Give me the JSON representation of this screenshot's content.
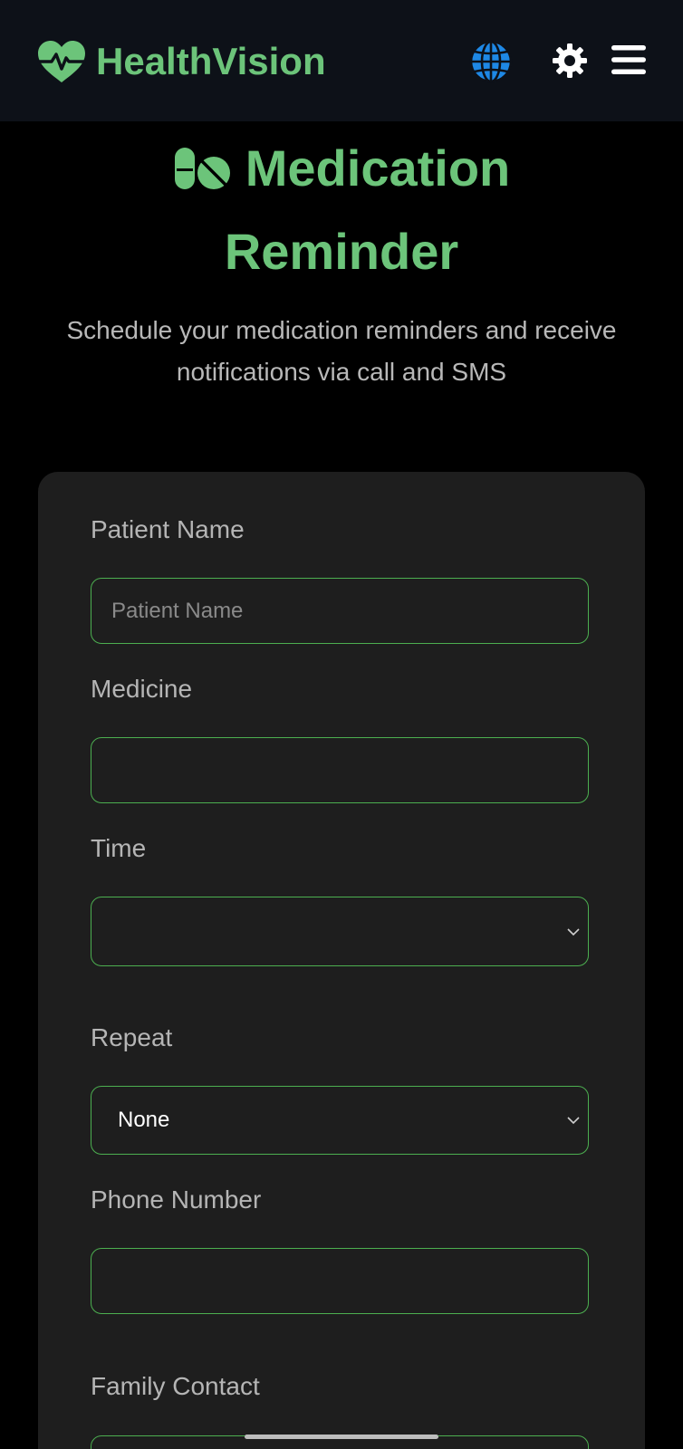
{
  "header": {
    "brand_name": "HealthVision",
    "icons": [
      "heartbeat-icon",
      "globe-icon",
      "gear-icon",
      "menu-icon"
    ]
  },
  "hero": {
    "title_line1": "Medication",
    "title_line2": "Reminder",
    "subtitle": "Schedule your medication reminders and receive notifications via call and SMS"
  },
  "form": {
    "patient_name": {
      "label": "Patient Name",
      "placeholder": "Patient Name",
      "value": ""
    },
    "medicine": {
      "label": "Medicine",
      "value": ""
    },
    "time": {
      "label": "Time",
      "value": ""
    },
    "repeat": {
      "label": "Repeat",
      "value": "None"
    },
    "phone": {
      "label": "Phone Number",
      "value": ""
    },
    "family_contact": {
      "label": "Family Contact",
      "value": ""
    }
  },
  "colors": {
    "accent": "#6cc47a",
    "border": "#4caf50",
    "background": "#000000",
    "header_bg": "#0d1118",
    "card_bg": "#1e1e1e"
  }
}
